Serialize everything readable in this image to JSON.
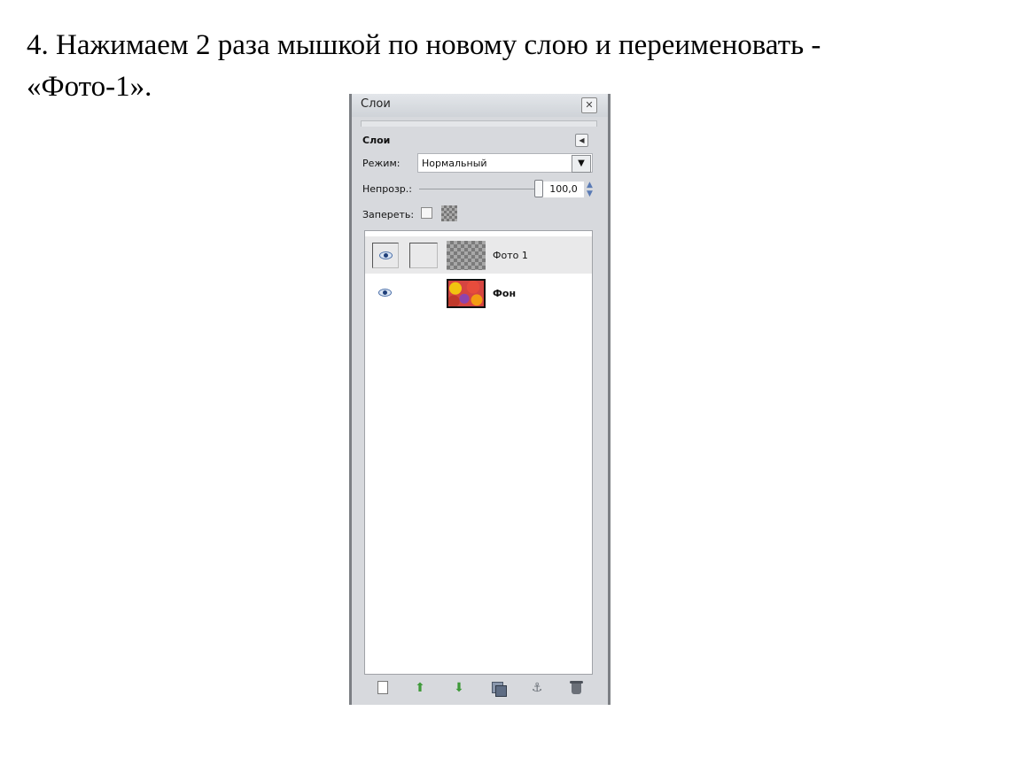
{
  "instruction": "4. Нажимаем 2 раза мышкой по новому слою  и переименовать -\n«Фото-1».",
  "panel": {
    "title": "Слои",
    "tab_label": "Слои",
    "mode_label": "Режим:",
    "mode_value": "Нормальный",
    "opacity_label": "Непрозр.:",
    "opacity_value": "100,0",
    "lock_label": "Запереть:"
  },
  "layers": [
    {
      "name": "Фото 1",
      "selected": true,
      "visible": true,
      "thumbnail": "transparent"
    },
    {
      "name": "Фон",
      "selected": false,
      "visible": true,
      "thumbnail": "photo"
    }
  ],
  "icons": {
    "close": "close-icon",
    "tab_menu": "tab-menu-icon",
    "eye": "eye-icon",
    "new_layer": "new-layer-icon",
    "raise": "raise-layer-icon",
    "lower": "lower-layer-icon",
    "duplicate": "duplicate-layer-icon",
    "anchor": "anchor-layer-icon",
    "delete": "delete-layer-icon"
  },
  "colors": {
    "panel_bg": "#d7d9dd",
    "selected_row": "#e9e9ea",
    "arrow_green": "#3f9a3a"
  }
}
